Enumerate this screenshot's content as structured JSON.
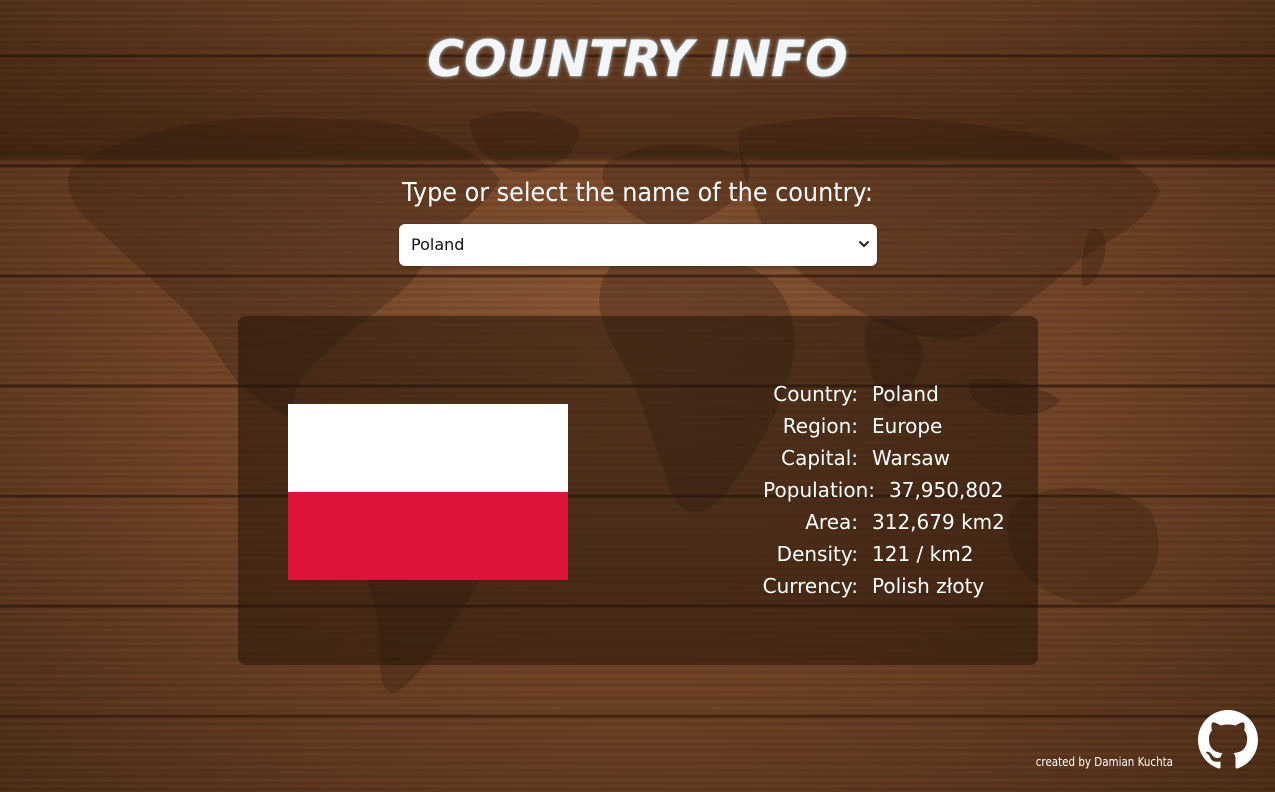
{
  "header": {
    "title": "COUNTRY INFO"
  },
  "search": {
    "prompt": "Type or select the name of the country:",
    "selected_value": "Poland"
  },
  "country_info": {
    "flag": {
      "description": "flag-of-poland",
      "colors": [
        "#ffffff",
        "#dc143c"
      ]
    },
    "rows": [
      {
        "label": "Country:",
        "value": "Poland"
      },
      {
        "label": "Region:",
        "value": "Europe"
      },
      {
        "label": "Capital:",
        "value": "Warsaw"
      },
      {
        "label": "Population:",
        "value": "37,950,802"
      },
      {
        "label": "Area:",
        "value": "312,679 km2"
      },
      {
        "label": "Density:",
        "value": "121 / km2"
      },
      {
        "label": "Currency:",
        "value": "Polish złoty"
      }
    ]
  },
  "footer": {
    "credit": "created by Damian Kuchta",
    "icon": "github-icon"
  },
  "colors": {
    "background_wood": "#6e4226",
    "panel_overlay": "rgba(35,20,10,0.55)",
    "title_glow": "#cfe6f2",
    "flag_red": "#dc143c"
  }
}
